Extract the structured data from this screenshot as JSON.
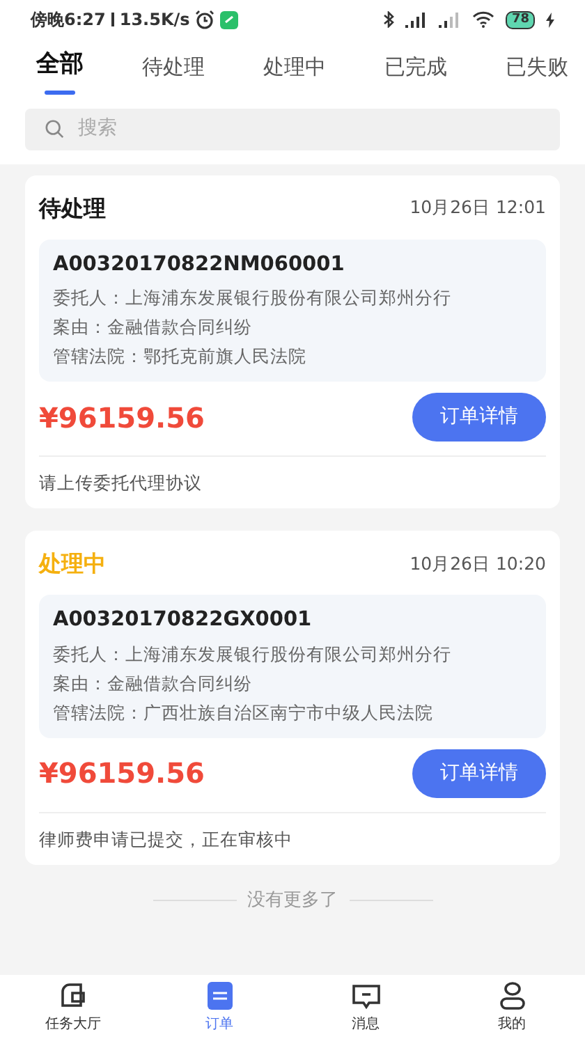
{
  "status_bar": {
    "time": "傍晚6:27",
    "speed": "13.5K/s",
    "battery": "78"
  },
  "tabs": [
    {
      "label": "全部",
      "selected": true
    },
    {
      "label": "待处理",
      "selected": false
    },
    {
      "label": "处理中",
      "selected": false
    },
    {
      "label": "已完成",
      "selected": false
    },
    {
      "label": "已失败",
      "selected": false
    }
  ],
  "search": {
    "placeholder": "搜索"
  },
  "orders": [
    {
      "status": "待处理",
      "color": "#1a1a1a",
      "time": "10月26日 12:01",
      "code": "A00320170822NM060001",
      "client": "委托人：上海浦东发展银行股份有限公司郑州分行",
      "cause": "案由：金融借款合同纠纷",
      "court": "管辖法院：鄂托克前旗人民法院",
      "amount": "¥96159.56",
      "button": "订单详情",
      "note": "请上传委托代理协议"
    },
    {
      "status": "处理中",
      "color": "#f5b00f",
      "time": "10月26日 10:20",
      "code": "A00320170822GX0001",
      "client": "委托人：上海浦东发展银行股份有限公司郑州分行",
      "cause": "案由：金融借款合同纠纷",
      "court": "管辖法院：广西壮族自治区南宁市中级人民法院",
      "amount": "¥96159.56",
      "button": "订单详情",
      "note": "律师费申请已提交，正在审核中"
    }
  ],
  "end_text": "没有更多了",
  "bottom_nav": [
    {
      "kind": "hall",
      "label": "任务大厅",
      "selected": false
    },
    {
      "kind": "order",
      "label": "订单",
      "selected": true
    },
    {
      "kind": "message",
      "label": "消息",
      "selected": false
    },
    {
      "kind": "me",
      "label": "我的",
      "selected": false
    }
  ]
}
